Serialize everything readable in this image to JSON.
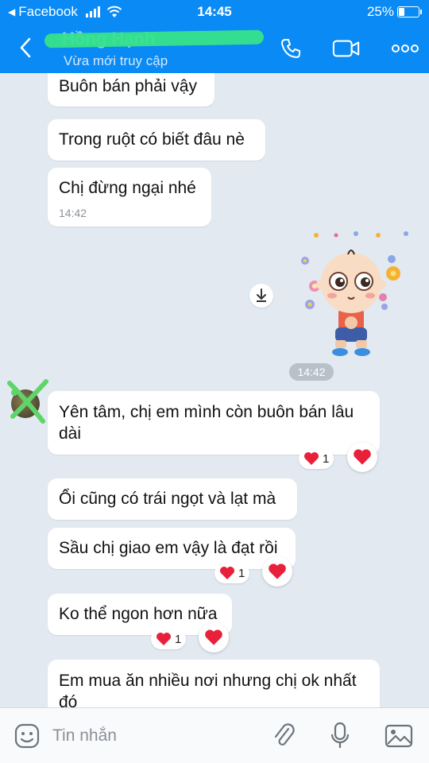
{
  "status_bar": {
    "back_app": "Facebook",
    "time": "14:45",
    "battery": "25%",
    "battery_level": 0.25
  },
  "header": {
    "contact_name": "Hồng Hạnh",
    "status": "Vừa mới truy cập",
    "icons": [
      "back-icon",
      "phone-icon",
      "video-icon",
      "more-icon"
    ]
  },
  "messages": [
    {
      "text": "Buôn bán phải vậy"
    },
    {
      "text": "Trong ruột có biết đâu nè"
    },
    {
      "text": "Chị đừng ngại nhé",
      "time": "14:42"
    },
    {
      "type": "sticker",
      "time": "14:42"
    },
    {
      "text_line1": "Yên tâm, chị em mình còn buôn bán lâu",
      "text_line2": "dài",
      "reaction_count": "1"
    },
    {
      "text": "Ổi cũng có trái ngọt và lạt mà"
    },
    {
      "text": "Sầu chị giao em vậy là đạt rồi",
      "reaction_count": "1"
    },
    {
      "text": "Ko thể ngon hơn nữa",
      "reaction_count": "1"
    },
    {
      "text_line1": "Em mua ăn nhiều nơi nhưng chị ok nhất",
      "text_line2": "đó"
    }
  ],
  "input": {
    "placeholder": "Tin nhắn",
    "icons": [
      "emoji-icon",
      "attachment-icon",
      "microphone-icon",
      "image-icon"
    ]
  },
  "colors": {
    "header_blue": "#0a8af5",
    "chat_background": "#e2e9f1",
    "bubble": "#ffffff",
    "heart": "#e8203a"
  }
}
